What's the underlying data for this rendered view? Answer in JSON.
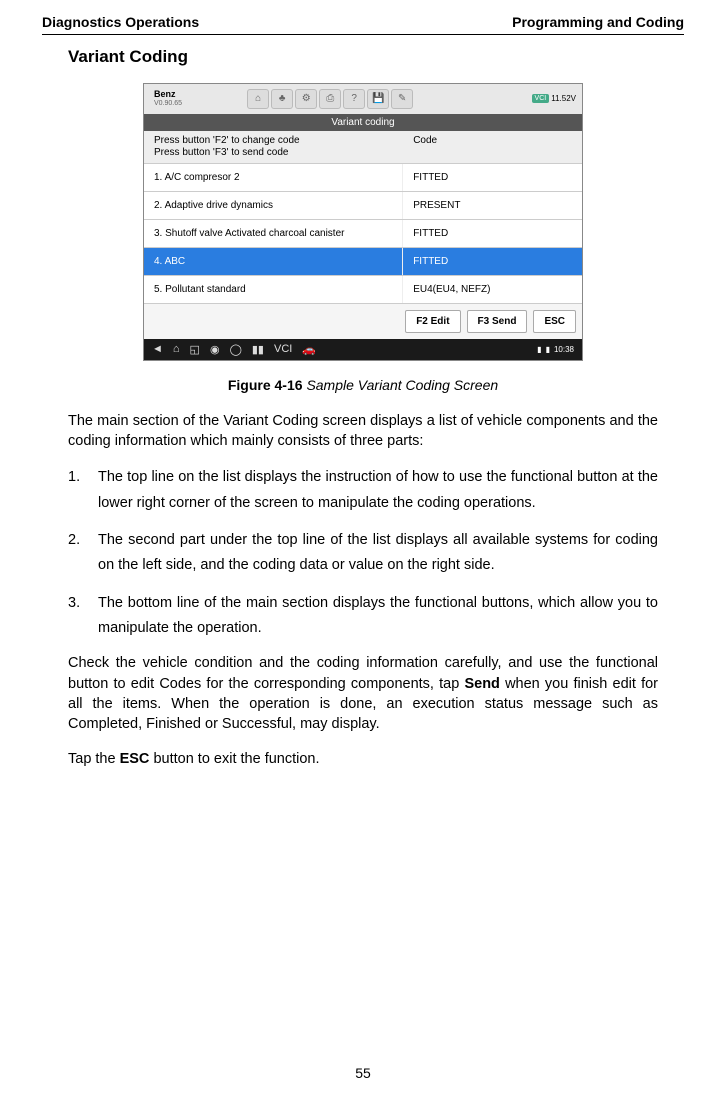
{
  "header": {
    "left": "Diagnostics Operations",
    "right": "Programming and Coding"
  },
  "section_title": "Variant Coding",
  "screenshot": {
    "brand": "Benz",
    "version": "V0.90.65",
    "vci": "VCI",
    "battery": "11.52V",
    "screen_title": "Variant coding",
    "instruction_line1": "Press button 'F2' to change code",
    "instruction_line2": "Press button 'F3' to send code",
    "code_header": "Code",
    "rows": [
      {
        "name": "1. A/C compresor 2",
        "value": "FITTED"
      },
      {
        "name": "2. Adaptive drive dynamics",
        "value": "PRESENT"
      },
      {
        "name": "3. Shutoff valve Activated charcoal canister",
        "value": "FITTED"
      },
      {
        "name": "4. ABC",
        "value": "FITTED"
      },
      {
        "name": "5. Pollutant standard",
        "value": "EU4(EU4, NEFZ)"
      }
    ],
    "buttons": {
      "f2": "F2 Edit",
      "f3": "F3 Send",
      "esc": "ESC"
    },
    "clock": "10:38"
  },
  "figure": {
    "label": "Figure 4-16",
    "desc": "Sample Variant Coding Screen"
  },
  "paragraphs": {
    "intro": "The main section of the Variant Coding screen displays a list of vehicle components and the coding information which mainly consists of three parts:",
    "check": "Check the vehicle condition and the coding information carefully, and use the functional button to edit Codes for the corresponding components, tap ",
    "check_bold": "Send",
    "check_after": " when you finish edit for all the items. When the operation is done, an execution status message such as Completed, Finished or Successful, may display.",
    "tap": "Tap the ",
    "tap_bold": "ESC",
    "tap_after": " button to exit the function."
  },
  "list": [
    "The top line on the list displays the instruction of how to use the functional button at the lower right corner of the screen to manipulate the coding operations.",
    "The second part under the top line of the list displays all available systems for coding on the left side, and the coding data or value on the right side.",
    "The bottom line of the main section displays the functional buttons, which allow you to manipulate the operation."
  ],
  "page_number": "55"
}
